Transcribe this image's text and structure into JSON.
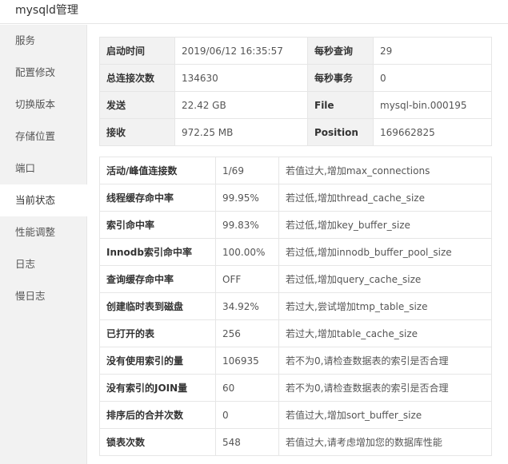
{
  "window": {
    "title": "mysqld管理"
  },
  "sidebar": {
    "items": [
      {
        "label": "服务",
        "active": false
      },
      {
        "label": "配置修改",
        "active": false
      },
      {
        "label": "切换版本",
        "active": false
      },
      {
        "label": "存储位置",
        "active": false
      },
      {
        "label": "端口",
        "active": false
      },
      {
        "label": "当前状态",
        "active": true
      },
      {
        "label": "性能调整",
        "active": false
      },
      {
        "label": "日志",
        "active": false
      },
      {
        "label": "慢日志",
        "active": false
      }
    ]
  },
  "info": {
    "rows": [
      {
        "k1": "启动时间",
        "v1": "2019/06/12 16:35:57",
        "k2": "每秒查询",
        "v2": "29"
      },
      {
        "k1": "总连接次数",
        "v1": "134630",
        "k2": "每秒事务",
        "v2": "0"
      },
      {
        "k1": "发送",
        "v1": "22.42 GB",
        "k2": "File",
        "v2": "mysql-bin.000195"
      },
      {
        "k1": "接收",
        "v1": "972.25 MB",
        "k2": "Position",
        "v2": "169662825"
      }
    ]
  },
  "status": {
    "rows": [
      {
        "name": "活动/峰值连接数",
        "value": "1/69",
        "tip": "若值过大,增加max_connections"
      },
      {
        "name": "线程缓存命中率",
        "value": "99.95%",
        "tip": "若过低,增加thread_cache_size"
      },
      {
        "name": "索引命中率",
        "value": "99.83%",
        "tip": "若过低,增加key_buffer_size"
      },
      {
        "name": "Innodb索引命中率",
        "value": "100.00%",
        "tip": "若过低,增加innodb_buffer_pool_size"
      },
      {
        "name": "查询缓存命中率",
        "value": "OFF",
        "tip": "若过低,增加query_cache_size"
      },
      {
        "name": "创建临时表到磁盘",
        "value": "34.92%",
        "tip": "若过大,尝试增加tmp_table_size"
      },
      {
        "name": "已打开的表",
        "value": "256",
        "tip": "若过大,增加table_cache_size"
      },
      {
        "name": "没有使用索引的量",
        "value": "106935",
        "tip": "若不为0,请检查数据表的索引是否合理"
      },
      {
        "name": "没有索引的JOIN量",
        "value": "60",
        "tip": "若不为0,请检查数据表的索引是否合理"
      },
      {
        "name": "排序后的合并次数",
        "value": "0",
        "tip": "若值过大,增加sort_buffer_size"
      },
      {
        "name": "锁表次数",
        "value": "548",
        "tip": "若值过大,请考虑增加您的数据库性能"
      }
    ]
  }
}
